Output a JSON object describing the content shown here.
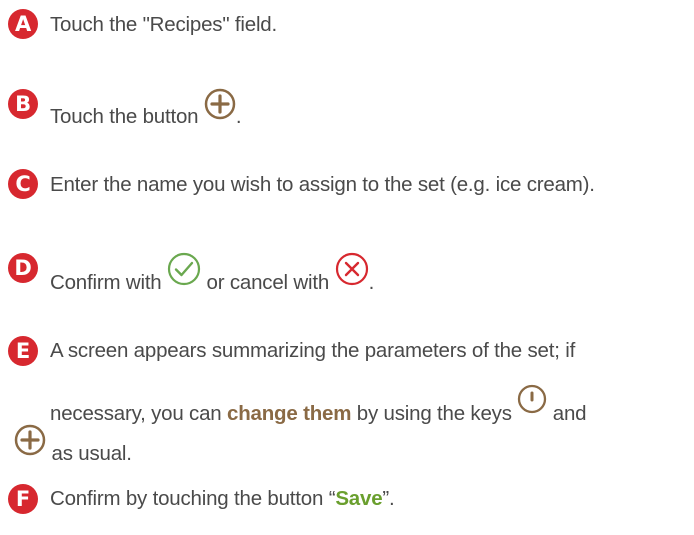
{
  "steps": [
    {
      "letter": "A",
      "text": "Touch the \"Recipes\" field."
    },
    {
      "letter": "B",
      "text_before": "Touch the button",
      "text_after": ".",
      "icon": "plus-circle-icon"
    },
    {
      "letter": "C",
      "text": "Enter the name you wish to assign to the set (e.g. ice cream)."
    },
    {
      "letter": "D",
      "text_1": "Confirm with",
      "icon_1": "check-circle-icon",
      "text_2": "or cancel with",
      "icon_2": "x-circle-icon",
      "text_3": "."
    },
    {
      "letter": "E",
      "line1": "A screen appears summarizing the parameters of the set; if",
      "line2_before": "necessary, you can",
      "line2_bold": "change them",
      "line2_after": "by using the keys",
      "line2_icon": "minus-circle-icon",
      "line2_end": "and",
      "line3_icon": "plus-circle-icon",
      "line3_text": "as usual."
    },
    {
      "letter": "F",
      "text_before": "Confirm by touching the button “",
      "bold": "Save",
      "text_after": "”."
    }
  ],
  "colors": {
    "badge": "#d7282f",
    "icon": "#8a6a45",
    "check": "#6aa84f",
    "cross": "#d7282f",
    "bold_emphasis": "#8a6a45",
    "save": "#6a9f2e"
  }
}
